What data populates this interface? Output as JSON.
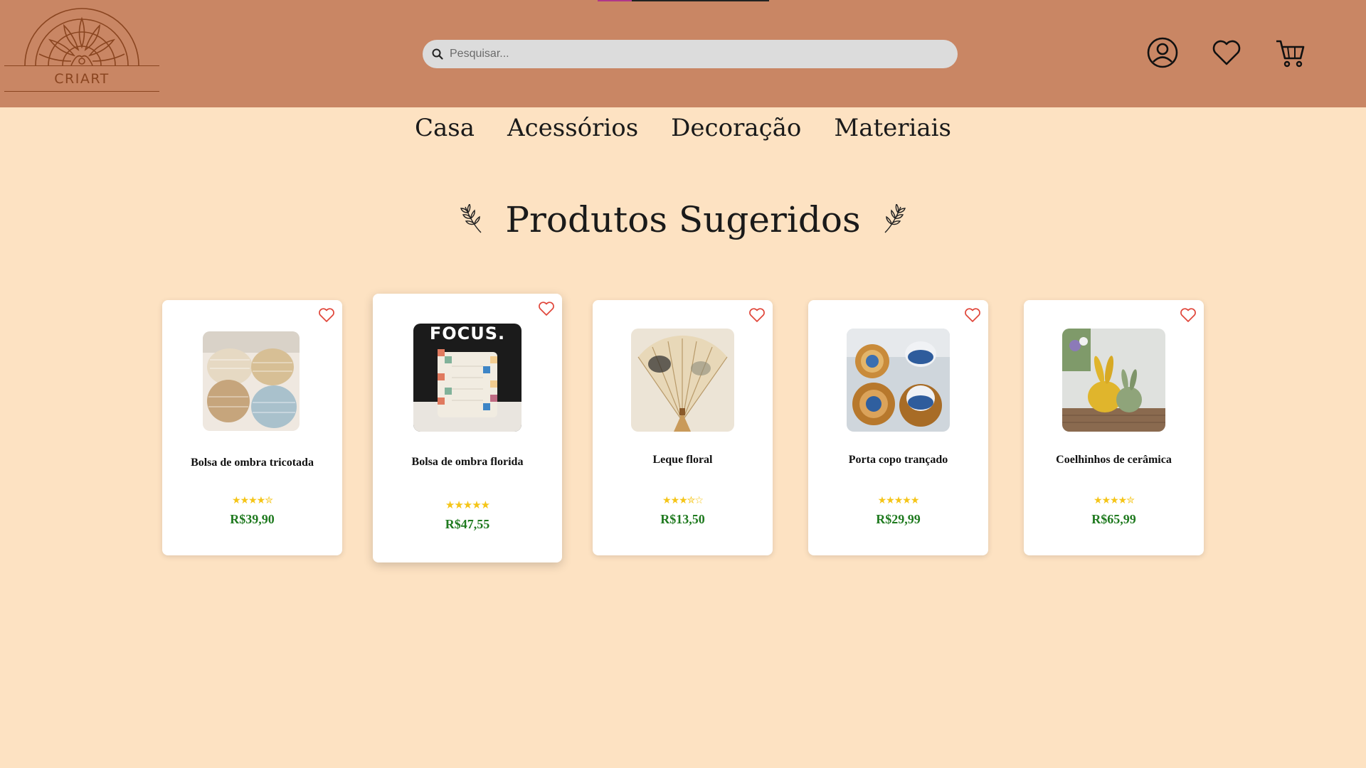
{
  "header": {
    "brand": "CRIART",
    "search_placeholder": "Pesquisar...",
    "icons": [
      "user-icon",
      "heart-icon",
      "cart-icon"
    ]
  },
  "nav": [
    "Casa",
    "Acessórios",
    "Decoração",
    "Materiais"
  ],
  "section_title": "Produtos Sugeridos",
  "products": [
    {
      "name": "Bolsa de ombra tricotada",
      "stars": "★★★★✮",
      "price": "R$39,90"
    },
    {
      "name": "Bolsa de ombra florida",
      "stars": "★★★★★",
      "price": "R$47,55",
      "image_caption": "FOCUS."
    },
    {
      "name": "Leque floral",
      "stars": "★★★✮☆",
      "price": "R$13,50"
    },
    {
      "name": "Porta copo trançado",
      "stars": "★★★★★",
      "price": "R$29,99"
    },
    {
      "name": "Coelhinhos de cerâmica",
      "stars": "★★★★✮",
      "price": "R$65,99"
    }
  ],
  "colors": {
    "header_bg": "#c98664",
    "page_bg": "#fde2c2",
    "price": "#1f7a1f",
    "star": "#f5c518",
    "fav": "#e0463a"
  }
}
